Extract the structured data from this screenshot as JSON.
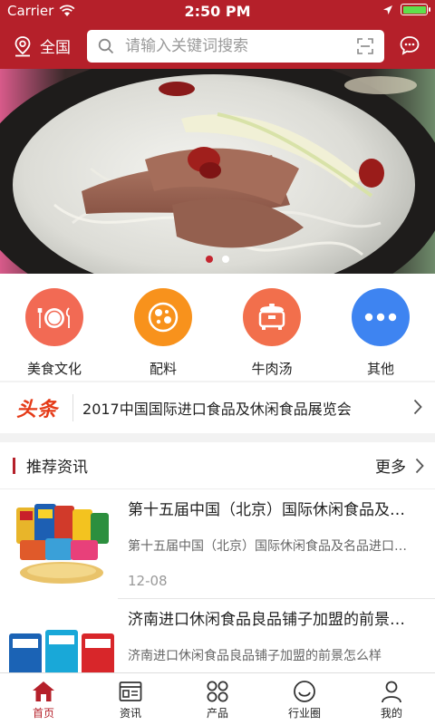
{
  "status": {
    "carrier": "Carrier",
    "time": "2:50 PM"
  },
  "header": {
    "location": "全国",
    "search_placeholder": "请输入关键词搜索"
  },
  "banner": {
    "slide_count": 2,
    "active_slide": 1
  },
  "categories": [
    {
      "label": "美食文化",
      "icon": "plate-icon",
      "color": "#f26a54"
    },
    {
      "label": "配料",
      "icon": "spice-plate-icon",
      "color": "#f8921c"
    },
    {
      "label": "牛肉汤",
      "icon": "rice-cooker-icon",
      "color": "#f26f4c"
    },
    {
      "label": "其他",
      "icon": "more-dots-icon",
      "color": "#3e84f1"
    }
  ],
  "headline": {
    "tag": "头条",
    "text": "2017中国国际进口食品及休闲食品展览会"
  },
  "recommend": {
    "title": "推荐资讯",
    "more": "更多"
  },
  "news": [
    {
      "title": "第十五届中国（北京）国际休闲食品及名品进口食品博览会",
      "desc": "第十五届中国（北京）国际休闲食品及名品进口食品博览会",
      "date": "12-08"
    },
    {
      "title": "济南进口休闲食品良品铺子加盟的前景怎么样",
      "desc": "济南进口休闲食品良品铺子加盟的前景怎么样",
      "date": ""
    }
  ],
  "tabs": [
    {
      "label": "首页",
      "icon": "home-icon",
      "active": true
    },
    {
      "label": "资讯",
      "icon": "news-icon",
      "active": false
    },
    {
      "label": "产品",
      "icon": "product-grid-icon",
      "active": false
    },
    {
      "label": "行业圈",
      "icon": "circle-smile-icon",
      "active": false
    },
    {
      "label": "我的",
      "icon": "user-icon",
      "active": false
    }
  ],
  "colors": {
    "brand": "#b5202a",
    "headline_tag": "#e53a17"
  }
}
